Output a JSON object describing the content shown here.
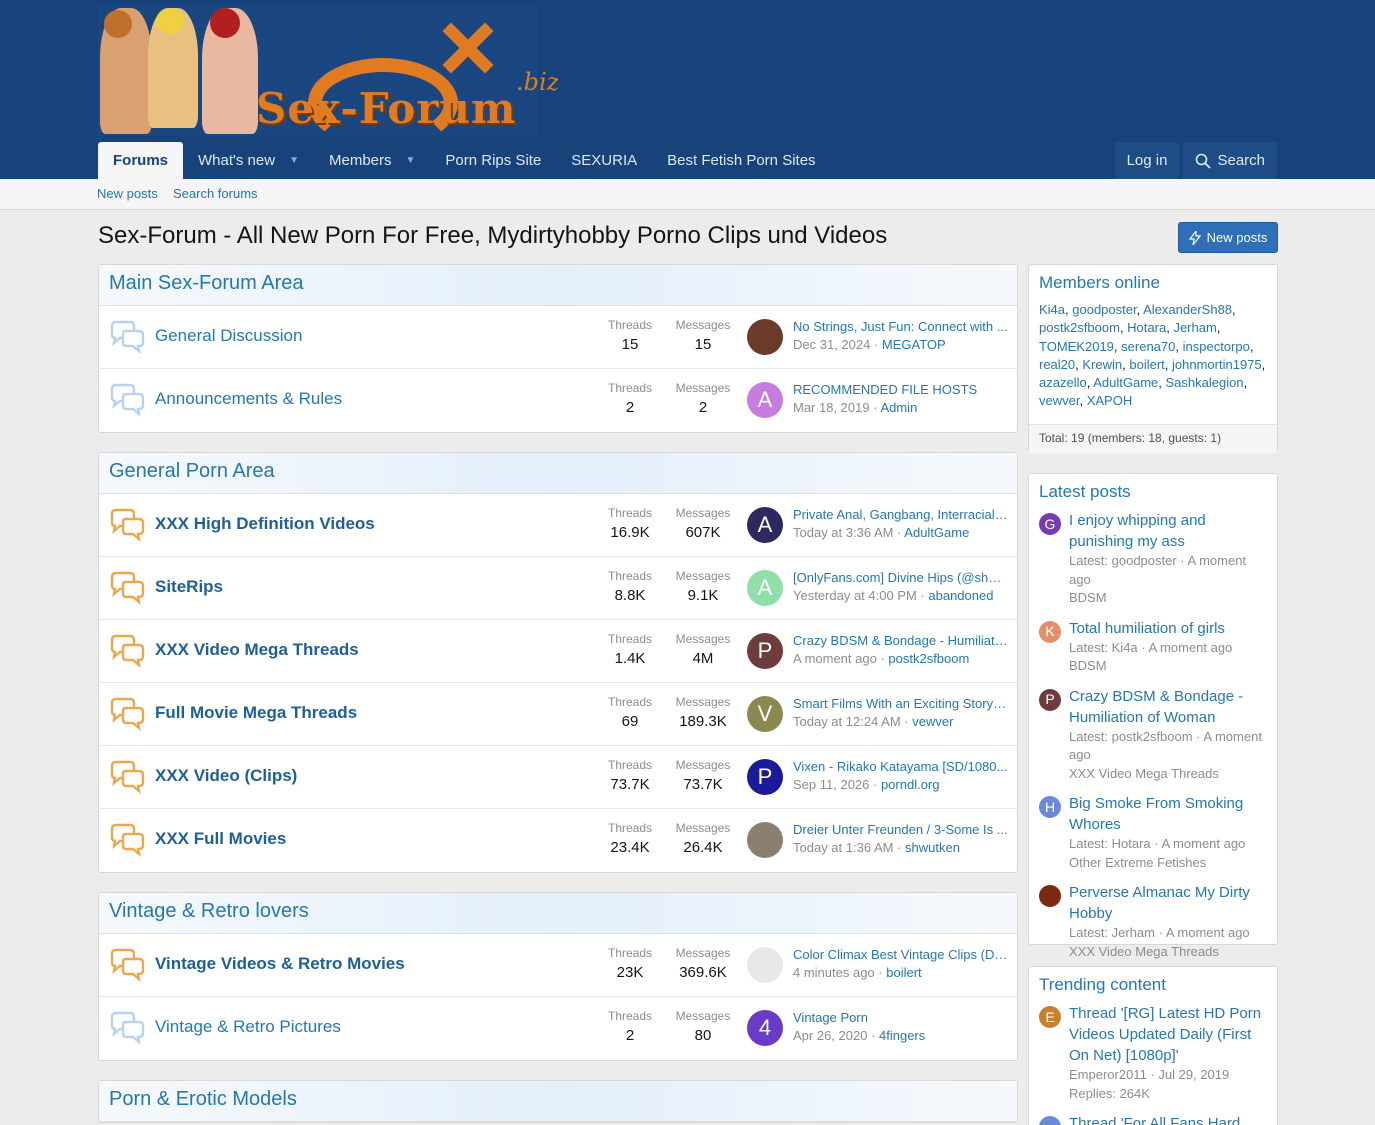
{
  "logo": {
    "text": "Sex-Forum",
    "suffix": ".biz"
  },
  "nav": {
    "tabs": [
      {
        "label": "Forums"
      },
      {
        "label": "What's new"
      },
      {
        "label": "Members"
      },
      {
        "label": "Porn Rips Site"
      },
      {
        "label": "SEXURIA"
      },
      {
        "label": "Best Fetish Porn Sites"
      }
    ],
    "login_label": "Log in",
    "search_label": "Search"
  },
  "subnav": {
    "new_posts": "New posts",
    "search_forums": "Search forums"
  },
  "page": {
    "title": "Sex-Forum - All New Porn For Free, Mydirtyhobby Porno Clips und Videos",
    "new_posts_btn": "New posts"
  },
  "labels": {
    "threads": "Threads",
    "messages": "Messages"
  },
  "categories": [
    {
      "title": "Main Sex-Forum Area",
      "nodes": [
        {
          "title": "General Discussion",
          "unread": false,
          "threads": "15",
          "messages": "15",
          "last_title": "No Strings, Just Fun: Connect with ...",
          "last_date": "Dec 31, 2024",
          "last_user": "MEGATOP",
          "avatar_letter": "",
          "avatar_color": "#6b3a2a"
        },
        {
          "title": "Announcements & Rules",
          "unread": false,
          "threads": "2",
          "messages": "2",
          "last_title": "RECOMMENDED FILE HOSTS",
          "last_date": "Mar 18, 2019",
          "last_user": "Admin",
          "avatar_letter": "A",
          "avatar_color": "#c77de0"
        }
      ]
    },
    {
      "title": "General Porn Area",
      "nodes": [
        {
          "title": "XXX High Definition Videos",
          "unread": true,
          "threads": "16.9K",
          "messages": "607K",
          "last_title": "Private Anal, Gangbang, Interracial, ...",
          "last_date": "Today at 3:36 AM",
          "last_user": "AdultGame",
          "avatar_letter": "A",
          "avatar_color": "#2a2a5e"
        },
        {
          "title": "SiteRips",
          "unread": true,
          "threads": "8.8K",
          "messages": "9.1K",
          "last_title": "[OnlyFans.com] Divine Hips (@shac...",
          "last_date": "Yesterday at 4:00 PM",
          "last_user": "abandoned",
          "avatar_letter": "A",
          "avatar_color": "#8ee0a8"
        },
        {
          "title": "XXX Video Mega Threads",
          "unread": true,
          "threads": "1.4K",
          "messages": "4M",
          "last_title": "Crazy BDSM & Bondage - Humiliati...",
          "last_date": "A moment ago",
          "last_user": "postk2sfboom",
          "avatar_letter": "P",
          "avatar_color": "#6e3c3c"
        },
        {
          "title": "Full Movie Mega Threads",
          "unread": true,
          "threads": "69",
          "messages": "189.3K",
          "last_title": "Smart Films With an Exciting Storyli...",
          "last_date": "Today at 12:24 AM",
          "last_user": "vewver",
          "avatar_letter": "V",
          "avatar_color": "#8a8a50"
        },
        {
          "title": "XXX Video (Clips)",
          "unread": true,
          "threads": "73.7K",
          "messages": "73.7K",
          "last_title": "Vixen - Rikako Katayama [SD/1080...",
          "last_date": "Sep 11, 2026",
          "last_user": "porndl.org",
          "avatar_letter": "P",
          "avatar_color": "#1a1a9a"
        },
        {
          "title": "XXX Full Movies",
          "unread": true,
          "threads": "23.4K",
          "messages": "26.4K",
          "last_title": "Dreier Unter Freunden / 3-Some Is ...",
          "last_date": "Today at 1:36 AM",
          "last_user": "shwutken",
          "avatar_letter": "",
          "avatar_color": "#8a8070"
        }
      ]
    },
    {
      "title": "Vintage & Retro lovers",
      "nodes": [
        {
          "title": "Vintage Videos & Retro Movies",
          "unread": true,
          "threads": "23K",
          "messages": "369.6K",
          "last_title": "Color Climax Best Vintage Clips (De...",
          "last_date": "4 minutes ago",
          "last_user": "boilert",
          "avatar_letter": "",
          "avatar_color": "#e8e8e8"
        },
        {
          "title": "Vintage & Retro Pictures",
          "unread": false,
          "threads": "2",
          "messages": "80",
          "last_title": "Vintage Porn",
          "last_date": "Apr 26, 2020",
          "last_user": "4fingers",
          "avatar_letter": "4",
          "avatar_color": "#6a3ac8"
        }
      ]
    },
    {
      "title": "Porn & Erotic Models",
      "nodes": []
    }
  ],
  "members_online": {
    "title": "Members online",
    "members": [
      "Ki4a",
      "goodposter",
      "AlexanderSh88",
      "postk2sfboom",
      "Hotara",
      "Jerham",
      "TOMEK2019",
      "serena70",
      "inspectorpo",
      "real20",
      "Krewin",
      "boilert",
      "johnmortin1975",
      "azazello",
      "AdultGame",
      "Sashkalegion",
      "vewver",
      "XAPOH"
    ],
    "total": "Total: 19 (members: 18, guests: 1)"
  },
  "latest_posts": {
    "title": "Latest posts",
    "items": [
      {
        "title": "I enjoy whipping and punishing my ass",
        "meta": "Latest: goodposter · A moment ago",
        "forum": "BDSM",
        "letter": "G",
        "color": "#7a3ab8"
      },
      {
        "title": "Total humiliation of girls",
        "meta": "Latest: Ki4a · A moment ago",
        "forum": "BDSM",
        "letter": "K",
        "color": "#e0906a"
      },
      {
        "title": "Crazy BDSM & Bondage - Humiliation of Woman",
        "meta": "Latest: postk2sfboom · A moment ago",
        "forum": "XXX Video Mega Threads",
        "letter": "P",
        "color": "#6e3c3c"
      },
      {
        "title": "Big Smoke From Smoking Whores",
        "meta": "Latest: Hotara · A moment ago",
        "forum": "Other Extreme Fetishes",
        "letter": "H",
        "color": "#6a8ad8"
      },
      {
        "title": "Perverse Almanac My Dirty Hobby",
        "meta": "Latest: Jerham · A moment ago",
        "forum": "XXX Video Mega Threads",
        "letter": "",
        "color": "#7a2a10"
      }
    ]
  },
  "trending": {
    "title": "Trending content",
    "items": [
      {
        "title": "Thread '[RG] Latest HD Porn Videos Updated Daily (First On Net) [1080p]'",
        "meta": "Emperor2011 · Jul 29, 2019",
        "replies": "Replies: 264K",
        "letter": "E",
        "color": "#c8802a"
      },
      {
        "title": "Thread 'For All Fans Hard",
        "meta": "",
        "replies": "",
        "letter": "",
        "color": "#6a8ad8"
      }
    ]
  },
  "colors": {
    "header": "#17437a",
    "link": "#2577b1",
    "accent": "#e07b22"
  }
}
